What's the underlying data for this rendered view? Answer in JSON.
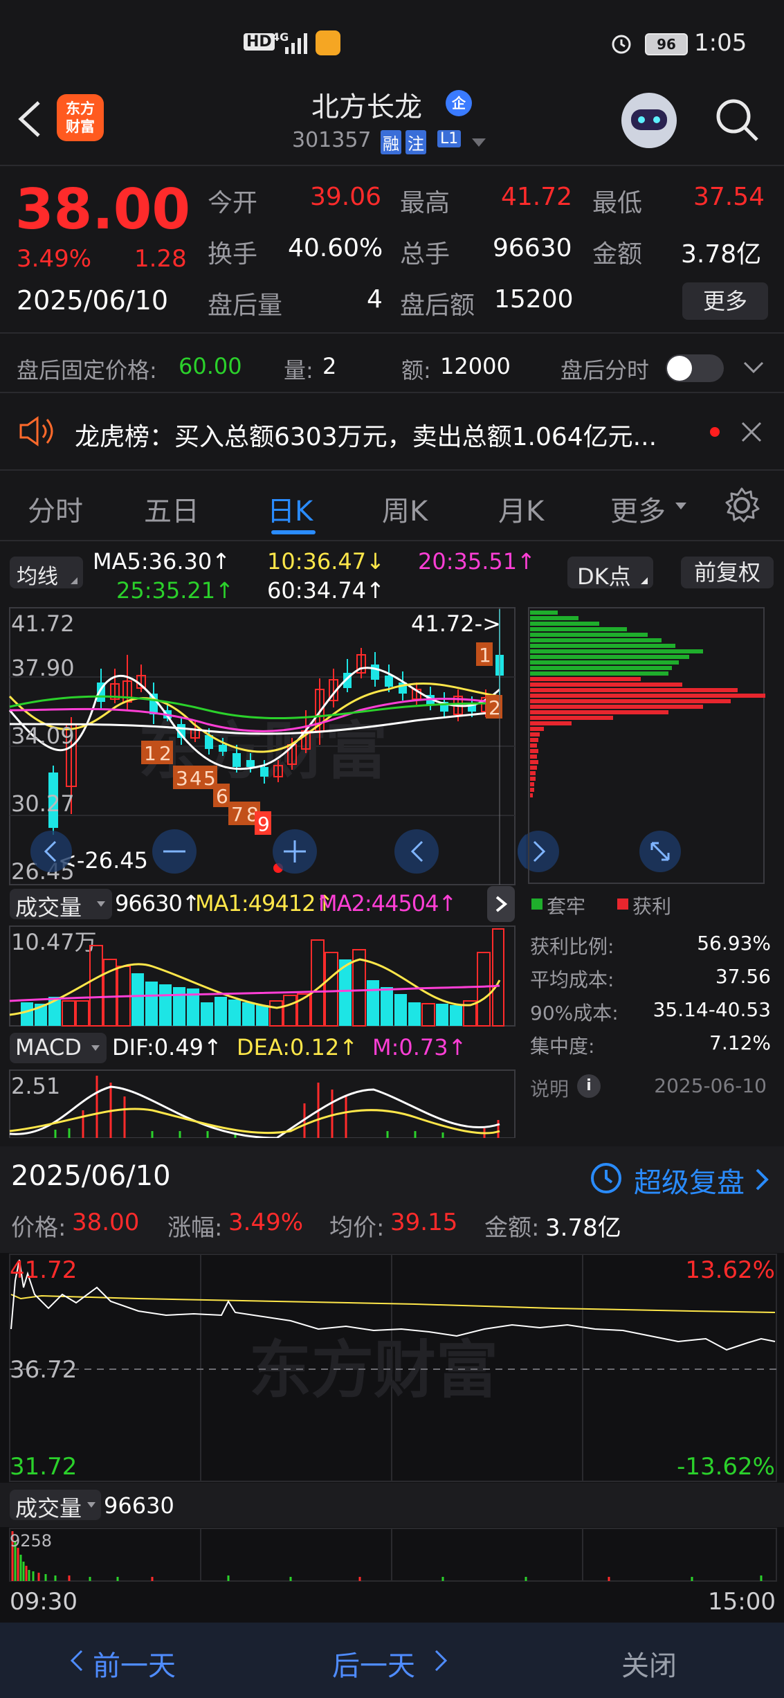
{
  "status_bar": {
    "hd": "HD",
    "network": "4G",
    "battery": "96",
    "time": "1:05"
  },
  "header": {
    "logo_text_1": "东方",
    "logo_text_2": "财富",
    "stock_name": "北方长龙",
    "badge_enterprise": "企",
    "code": "301357",
    "tag_rong": "融",
    "tag_zhu": "注",
    "tag_l1": "L1"
  },
  "quote": {
    "price": "38.00",
    "change_pct": "3.49%",
    "change_amt": "1.28",
    "date": "2025/06/10",
    "open_label": "今开",
    "open": "39.06",
    "high_label": "最高",
    "high": "41.72",
    "low_label": "最低",
    "low": "37.54",
    "turnover_label": "换手",
    "turnover": "40.60%",
    "volume_label": "总手",
    "volume": "96630",
    "amount_label": "金额",
    "amount": "3.78亿",
    "after_vol_label": "盘后量",
    "after_vol": "4",
    "after_amt_label": "盘后额",
    "after_amt": "15200",
    "more_button": "更多"
  },
  "after_hours": {
    "fixed_price_label": "盘后固定价格:",
    "fixed_price": "60.00",
    "qty_label": "量:",
    "qty": "2",
    "amt_label": "额:",
    "amt": "12000",
    "intraday_label": "盘后分时"
  },
  "notice": {
    "text": "龙虎榜：买入总额6303万元，卖出总额1.064亿元..."
  },
  "tabs": [
    {
      "label": "分时"
    },
    {
      "label": "五日"
    },
    {
      "label": "日K"
    },
    {
      "label": "周K"
    },
    {
      "label": "月K"
    },
    {
      "label": "更多"
    }
  ],
  "kline": {
    "ma_selector": "均线",
    "ma5": "MA5:36.30↑",
    "ma10": "10:36.47↓",
    "ma20": "20:35.51↑",
    "ma25": "25:35.21↑",
    "ma60": "60:34.74↑",
    "dk_button": "DK点",
    "fq_button": "前复权",
    "y_labels": [
      "41.72",
      "37.90",
      "34.09",
      "30.27",
      "26.45"
    ],
    "high_marker": "41.72->",
    "low_marker": "<-26.45",
    "seq_labels": [
      "1",
      "2",
      "1",
      "2",
      "3",
      "4",
      "5",
      "6",
      "7",
      "8",
      "9"
    ],
    "watermark": "东方财富",
    "colors": {
      "up": "#ff2b2b",
      "down": "#1de5e5",
      "ma5": "#ffffff",
      "ma10": "#ffe74a",
      "ma20": "#ff3fd6",
      "ma25": "#2bd12b",
      "ma60": "#ffffff"
    }
  },
  "volume_panel": {
    "selector": "成交量",
    "vol": "96630↑",
    "ma1": "MA1:49412↑",
    "ma2": "MA2:44504↑",
    "top_label": "10.47万"
  },
  "macd_panel": {
    "selector": "MACD",
    "dif": "DIF:0.49↑",
    "dea": "DEA:0.12↑",
    "m": "M:0.73↑",
    "top_label": "2.51"
  },
  "chip": {
    "legend_trapped": "套牢",
    "legend_profit": "获利",
    "profit_ratio_label": "获利比例:",
    "profit_ratio": "56.93%",
    "avg_cost_label": "平均成本:",
    "avg_cost": "37.56",
    "cost90_label": "90%成本:",
    "cost90": "35.14-40.53",
    "concentration_label": "集中度:",
    "concentration": "7.12%",
    "note_label": "说明",
    "note_date": "2025-06-10"
  },
  "intraday": {
    "date": "2025/06/10",
    "replay_label": "超级复盘",
    "price_label": "价格:",
    "price": "38.00",
    "chg_label": "涨幅:",
    "chg": "3.49%",
    "avg_label": "均价:",
    "avg": "39.15",
    "amount_label": "金额:",
    "amount": "3.78亿",
    "top_price": "41.72",
    "mid_price": "36.72",
    "bottom_price": "31.72",
    "top_pct": "13.62%",
    "bottom_pct": "-13.62%",
    "vol_selector": "成交量",
    "vol": "96630",
    "vol_top": "9258",
    "time_start": "09:30",
    "time_end": "15:00",
    "watermark": "东方财富"
  },
  "bottom_nav": {
    "prev": "前一天",
    "next": "后一天",
    "close": "关闭"
  }
}
